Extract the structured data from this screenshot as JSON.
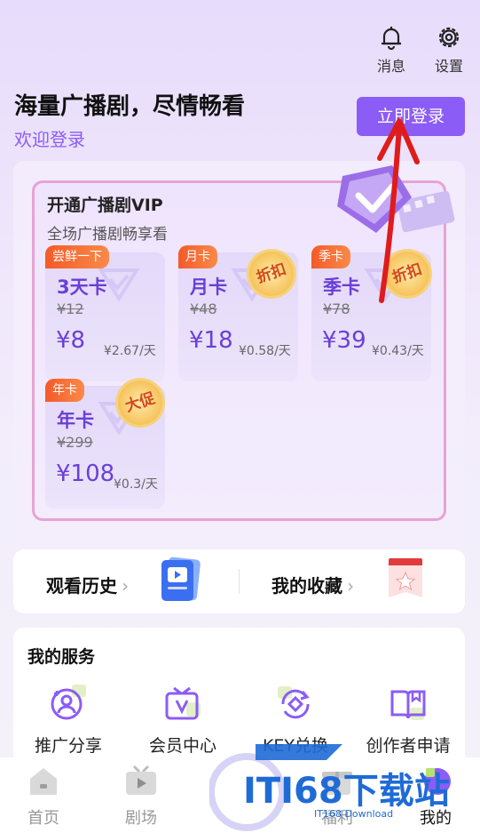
{
  "header": {
    "messages_label": "消息",
    "settings_label": "设置",
    "slogan": "海量广播剧，尽情畅看",
    "welcome": "欢迎登录",
    "login_button": "立即登录"
  },
  "vip": {
    "title": "开通广播剧VIP",
    "subtitle": "全场广播剧畅享看",
    "plans": [
      {
        "tag": "尝鲜一下",
        "name": "3天卡",
        "original": "¥12",
        "price": "¥8",
        "per_day": "¥2.67/天",
        "badge": ""
      },
      {
        "tag": "月卡",
        "name": "月卡",
        "original": "¥48",
        "price": "¥18",
        "per_day": "¥0.58/天",
        "badge": "折扣"
      },
      {
        "tag": "季卡",
        "name": "季卡",
        "original": "¥78",
        "price": "¥39",
        "per_day": "¥0.43/天",
        "badge": "折扣"
      },
      {
        "tag": "年卡",
        "name": "年卡",
        "original": "¥299",
        "price": "¥108",
        "per_day": "¥0.3/天",
        "badge": "大促"
      }
    ]
  },
  "shortcuts": {
    "history": "观看历史",
    "favorites": "我的收藏"
  },
  "services": {
    "title": "我的服务",
    "items": [
      {
        "label": "推广分享",
        "icon": "share-person-icon"
      },
      {
        "label": "会员中心",
        "icon": "vip-tv-icon"
      },
      {
        "label": "KEY兑换",
        "icon": "key-exchange-icon"
      },
      {
        "label": "创作者申请",
        "icon": "book-icon"
      }
    ]
  },
  "nav": {
    "items": [
      {
        "label": "首页",
        "icon": "home-icon"
      },
      {
        "label": "剧场",
        "icon": "theater-icon"
      },
      {
        "label": "福利",
        "icon": "gift-icon"
      },
      {
        "label": "我的",
        "icon": "profile-icon"
      }
    ]
  },
  "watermark": {
    "text": "ITI68下载站",
    "sub": "IT168 Download"
  },
  "colors": {
    "accent": "#8b5cf6",
    "price": "#6a3fd6",
    "tag": "#f45a28",
    "annotation_arrow": "#e01b1b"
  }
}
